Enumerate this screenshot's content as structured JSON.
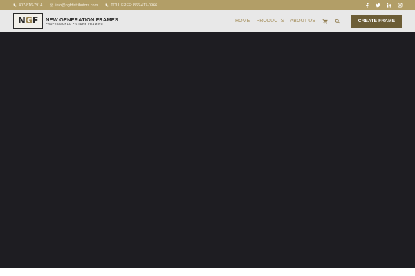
{
  "topbar": {
    "phone": "407-816-7914",
    "email": "info@ngfdistributors.com",
    "toll_free": "TOLL FREE: 866-417-0966",
    "icons": [
      "phone-icon",
      "envelope-icon",
      "phone-icon"
    ],
    "social": [
      "facebook-icon",
      "twitter-icon",
      "linkedin-icon",
      "instagram-icon"
    ]
  },
  "logo": {
    "mark_left": "N",
    "mark_mid": "G",
    "mark_right": "F",
    "title": "NEW GENERATION FRAMES",
    "subtitle": "PROFESSIONAL PICTURE FRAMING"
  },
  "nav": {
    "items": [
      "HOME",
      "PRODUCTS",
      "ABOUT US"
    ],
    "cart_icon": "cart-icon",
    "search_icon": "search-icon",
    "cta": "CREATE FRAME"
  },
  "colors": {
    "topbar": "#b29e67",
    "navbar": "#e8e8e8",
    "accent": "#a48e5a",
    "cta": "#6c5d36",
    "hero": "#1e1d22"
  }
}
